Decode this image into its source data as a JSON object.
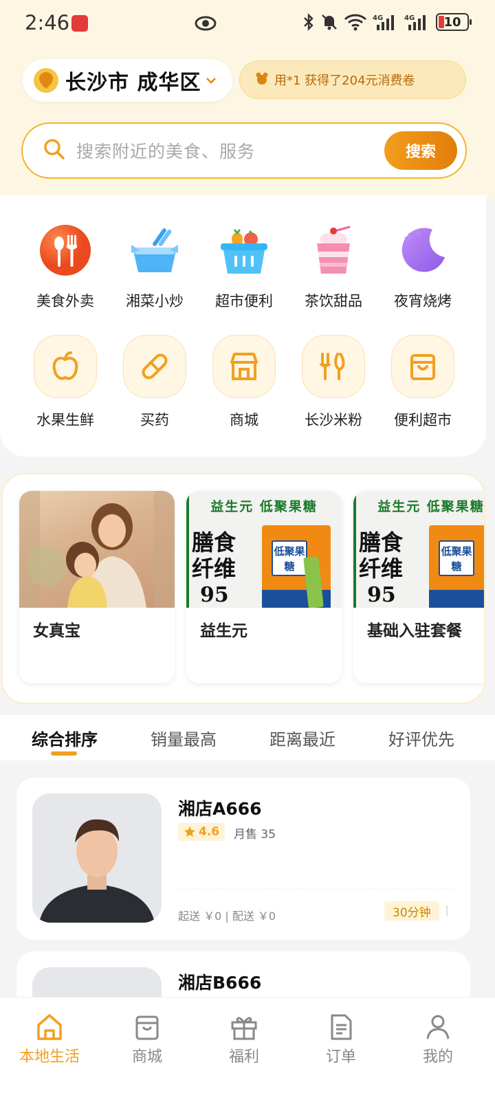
{
  "status_bar": {
    "time": "2:46",
    "battery": "10"
  },
  "header": {
    "location": "长沙市 成华区",
    "coupon_text": "用*1 获得了204元消费卷"
  },
  "search": {
    "placeholder": "搜索附近的美食、服务",
    "button": "搜索"
  },
  "categories_primary": [
    {
      "label": "美食外卖",
      "icon": "fork-spoon-icon"
    },
    {
      "label": "湘菜小炒",
      "icon": "bowl-icon"
    },
    {
      "label": "超市便利",
      "icon": "basket-icon"
    },
    {
      "label": "茶饮甜品",
      "icon": "drink-icon"
    },
    {
      "label": "夜宵烧烤",
      "icon": "moon-icon"
    }
  ],
  "categories_secondary": [
    {
      "label": "水果生鲜",
      "icon": "apple-icon"
    },
    {
      "label": "买药",
      "icon": "pill-icon"
    },
    {
      "label": "商城",
      "icon": "store-icon"
    },
    {
      "label": "长沙米粉",
      "icon": "noodle-icon"
    },
    {
      "label": "便利超市",
      "icon": "bag-icon"
    }
  ],
  "recommend": [
    {
      "title": "女真宝",
      "image": "mother-daughter-illustration"
    },
    {
      "title": "益生元",
      "image": "prebiotic-product",
      "header": "益生元 低聚果糖",
      "big_text": "膳食纤维",
      "number": "95",
      "box_label": "低聚果糖"
    },
    {
      "title": "基础入驻套餐",
      "image": "prebiotic-product",
      "header": "益生元 低聚果糖",
      "big_text": "膳食纤维",
      "number": "95",
      "box_label": "低聚果糖"
    }
  ],
  "sort_tabs": [
    "综合排序",
    "销量最高",
    "距离最近",
    "好评优先"
  ],
  "active_sort_tab": 0,
  "shops": [
    {
      "name": "湘店A666",
      "rating": "4.6",
      "monthly_sales": "月售 35",
      "fee": "起送 ￥0 | 配送 ￥0",
      "delivery_time": "30分钟"
    },
    {
      "name": "湘店B666"
    }
  ],
  "bottom_nav": [
    "本地生活",
    "商城",
    "福利",
    "订单",
    "我的"
  ],
  "active_nav": 0,
  "colors": {
    "accent": "#f0a020",
    "header_bg": "#fdf6e3",
    "brand_orange": "#e27e0a"
  }
}
